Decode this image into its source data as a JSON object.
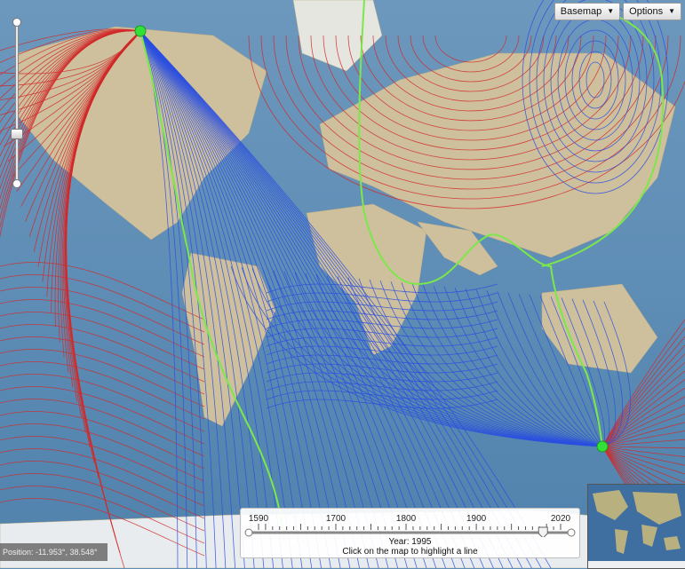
{
  "toolbar": {
    "basemap_label": "Basemap",
    "options_label": "Options"
  },
  "timeline": {
    "ticks": [
      "1590",
      "1700",
      "1800",
      "1900",
      "2020"
    ],
    "tick_years": [
      1590,
      1700,
      1800,
      1900,
      2020
    ],
    "selected_year": 1995,
    "year_text": "Year: 1995",
    "hint_text": "Click on the map to highlight a line"
  },
  "position": {
    "text": "Position: -11.953°, 38.548°"
  },
  "colors": {
    "ocean": "#5d8fb6",
    "land": "#cdbd98",
    "positive_lines": "#d12a2a",
    "negative_lines": "#2a4fe0",
    "zero_line": "#7be84a",
    "pole": "#33e03a"
  },
  "icons": {
    "basemap_caret": "caret-down-icon",
    "options_caret": "caret-down-icon"
  }
}
